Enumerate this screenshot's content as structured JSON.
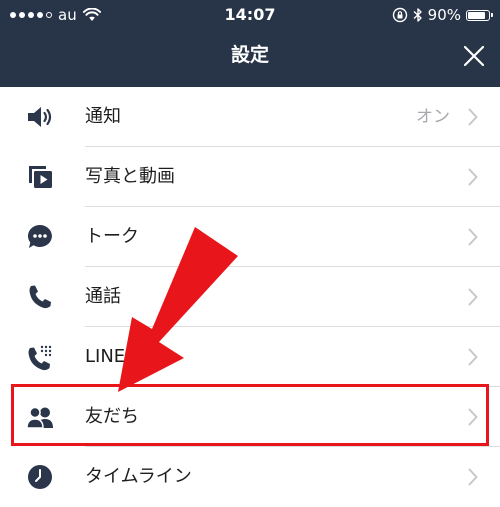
{
  "status_bar": {
    "carrier": "au",
    "time": "14:07",
    "battery_percent_label": "90%",
    "battery_level": 0.9,
    "icons": [
      "signal-icon",
      "wifi-icon",
      "orientation-lock-icon",
      "bluetooth-icon",
      "battery-icon"
    ]
  },
  "header": {
    "title": "設定",
    "close_icon": "close-icon"
  },
  "settings": [
    {
      "icon": "speaker-icon",
      "label": "通知",
      "value": "オン"
    },
    {
      "icon": "photo-video-icon",
      "label": "写真と動画",
      "value": ""
    },
    {
      "icon": "chat-bubble-icon",
      "label": "トーク",
      "value": ""
    },
    {
      "icon": "phone-icon",
      "label": "通話",
      "value": ""
    },
    {
      "icon": "line-out-phone-icon",
      "label": "LINE Out",
      "value": ""
    },
    {
      "icon": "friends-icon",
      "label": "友だち",
      "value": ""
    },
    {
      "icon": "clock-icon",
      "label": "タイムライン",
      "value": ""
    }
  ],
  "annotation": {
    "highlighted_item": "友だち",
    "highlight_color": "#e8161b",
    "arrow_color": "#e8161b"
  },
  "colors": {
    "header_bg": "#283447",
    "icon_color": "#2b364a",
    "chevron_color": "#c7c7cc",
    "divider": "#dcdce0"
  }
}
